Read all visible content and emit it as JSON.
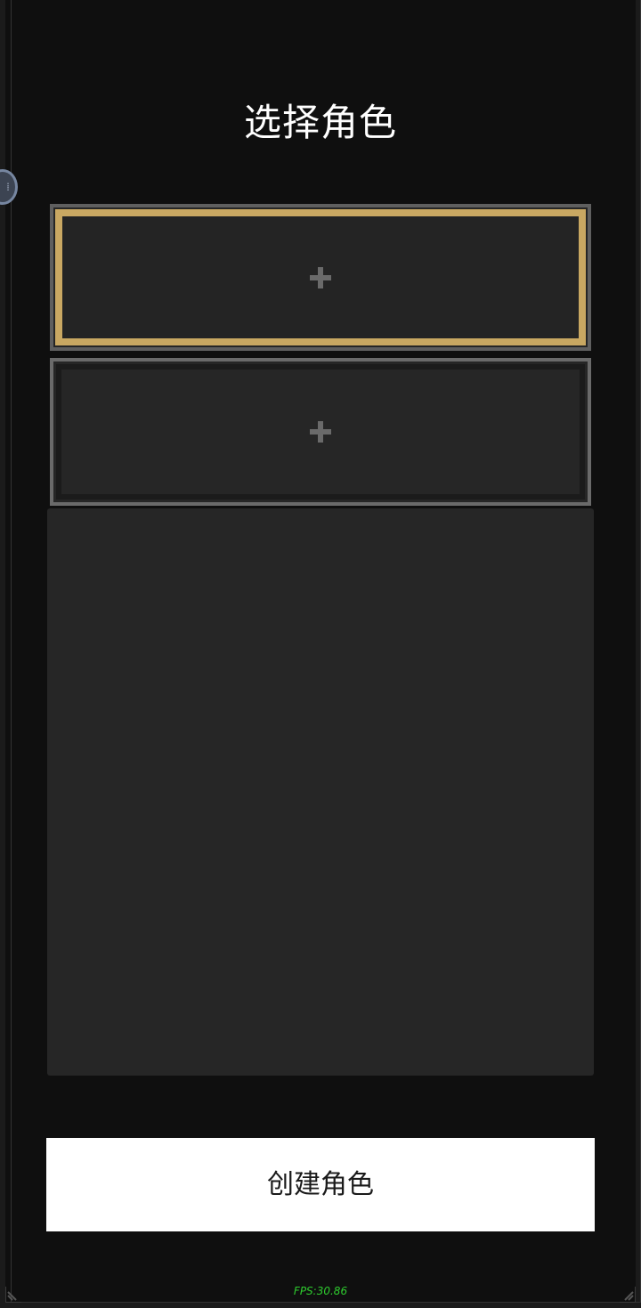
{
  "screen": {
    "title": "选择角色"
  },
  "slots": [
    {
      "icon": "plus-icon",
      "selected": true,
      "border_color": "#c9a862"
    },
    {
      "icon": "plus-icon",
      "selected": false,
      "border_color": "#6a6a6a"
    }
  ],
  "actions": {
    "create_label": "创建角色"
  },
  "debug": {
    "fps_text": "FPS:30.86"
  },
  "colors": {
    "background": "#0f0f0f",
    "panel": "#262626",
    "accent_gold": "#c9a862",
    "fps_green": "#2ecc2e"
  }
}
